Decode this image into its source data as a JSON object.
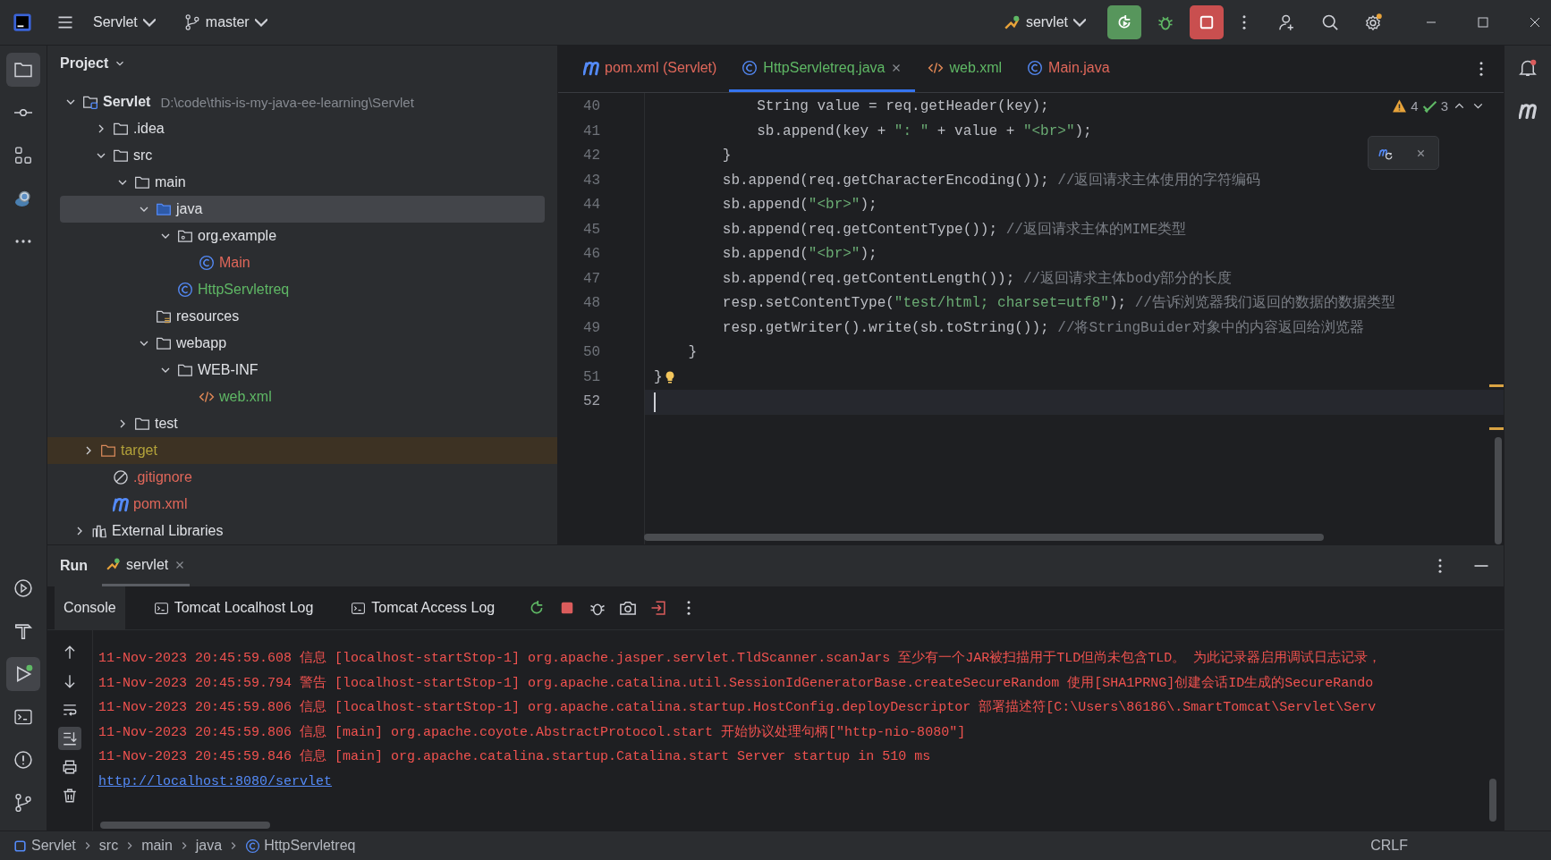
{
  "title_bar": {
    "project": "Servlet",
    "branch": "master",
    "run_config": "servlet"
  },
  "tool_strip": {
    "top": [
      {
        "kind": "folder",
        "selected": true
      },
      {
        "kind": "commit",
        "selected": false
      },
      {
        "kind": "structure",
        "selected": false
      },
      {
        "kind": "plugin",
        "selected": false
      },
      {
        "kind": "more",
        "selected": false
      }
    ],
    "bottom": [
      {
        "kind": "services",
        "selected": false
      },
      {
        "kind": "build",
        "selected": false
      },
      {
        "kind": "run",
        "selected": true
      },
      {
        "kind": "terminal",
        "selected": false
      },
      {
        "kind": "problems",
        "selected": false
      },
      {
        "kind": "git",
        "selected": false
      }
    ]
  },
  "project": {
    "title": "Project",
    "tree": [
      {
        "label": "Servlet",
        "hint": "D:\\code\\this-is-my-java-ee-learning\\Servlet",
        "kind": "module",
        "expanded": true,
        "selected": false,
        "children": [
          {
            "label": ".idea",
            "kind": "folder",
            "expanded": false,
            "selected": false
          },
          {
            "label": "src",
            "kind": "folder",
            "expanded": true,
            "selected": false,
            "children": [
              {
                "label": "main",
                "kind": "folder",
                "expanded": true,
                "selected": false,
                "children": [
                  {
                    "label": "java",
                    "kind": "source",
                    "expanded": true,
                    "selected": true,
                    "children": [
                      {
                        "label": "org.example",
                        "kind": "package",
                        "expanded": true,
                        "selected": false,
                        "children": [
                          {
                            "label": "Main",
                            "kind": "class",
                            "color": "#e0675a",
                            "selected": false
                          }
                        ]
                      },
                      {
                        "label": "HttpServletreq",
                        "kind": "class",
                        "color": "#5fb865",
                        "selected": false
                      }
                    ]
                  },
                  {
                    "label": "resources",
                    "kind": "resources",
                    "selected": false
                  },
                  {
                    "label": "webapp",
                    "kind": "folder",
                    "expanded": true,
                    "selected": false,
                    "children": [
                      {
                        "label": "WEB-INF",
                        "kind": "folder",
                        "expanded": true,
                        "selected": false,
                        "children": [
                          {
                            "label": "web.xml",
                            "kind": "xml",
                            "color": "#5fb865",
                            "selected": false
                          }
                        ]
                      }
                    ]
                  }
                ]
              },
              {
                "label": "test",
                "kind": "folder",
                "expanded": false,
                "selected": false
              }
            ]
          },
          {
            "label": "target",
            "kind": "excluded",
            "expanded": false,
            "color": "#b3a23a",
            "ignored": true,
            "selected": false
          },
          {
            "label": ".gitignore",
            "kind": "ignore",
            "color": "#e0675a",
            "selected": false
          },
          {
            "label": "pom.xml",
            "kind": "maven",
            "color": "#e0675a",
            "selected": false
          }
        ]
      },
      {
        "label": "External Libraries",
        "kind": "library",
        "expanded": false,
        "selected": false
      }
    ]
  },
  "editor": {
    "tabs": [
      {
        "label": "pom.xml (Servlet)",
        "kind": "maven",
        "color": "#e0675a",
        "selected": false
      },
      {
        "label": "HttpServletreq.java",
        "kind": "class",
        "color": "#5fb865",
        "selected": true
      },
      {
        "label": "web.xml",
        "kind": "xml",
        "color": "#5fb865",
        "selected": false
      },
      {
        "label": "Main.java",
        "kind": "class",
        "color": "#e0675a",
        "selected": false
      }
    ],
    "inspections": {
      "warnings": "4",
      "checks": "3"
    },
    "lines": [
      {
        "number": "40",
        "current": false,
        "segments": [
          {
            "kind": "code",
            "text": "            String value = req.getHeader(key);"
          }
        ]
      },
      {
        "number": "41",
        "current": false,
        "segments": [
          {
            "kind": "code",
            "text": "            sb.append(key + "
          },
          {
            "kind": "string",
            "text": "\": \""
          },
          {
            "kind": "code",
            "text": " + value + "
          },
          {
            "kind": "string",
            "text": "\"<br>\""
          },
          {
            "kind": "code",
            "text": ");"
          }
        ]
      },
      {
        "number": "42",
        "current": false,
        "segments": [
          {
            "kind": "code",
            "text": "        }"
          }
        ]
      },
      {
        "number": "43",
        "current": false,
        "segments": [
          {
            "kind": "code",
            "text": "        sb.append(req.getCharacterEncoding()); "
          },
          {
            "kind": "comment",
            "text": "//返回请求主体使用的字符编码"
          }
        ]
      },
      {
        "number": "44",
        "current": false,
        "segments": [
          {
            "kind": "code",
            "text": "        sb.append("
          },
          {
            "kind": "string",
            "text": "\"<br>\""
          },
          {
            "kind": "code",
            "text": ");"
          }
        ]
      },
      {
        "number": "45",
        "current": false,
        "segments": [
          {
            "kind": "code",
            "text": "        sb.append(req.getContentType()); "
          },
          {
            "kind": "comment",
            "text": "//返回请求主体的MIME类型"
          }
        ]
      },
      {
        "number": "46",
        "current": false,
        "segments": [
          {
            "kind": "code",
            "text": "        sb.append("
          },
          {
            "kind": "string",
            "text": "\"<br>\""
          },
          {
            "kind": "code",
            "text": ");"
          }
        ]
      },
      {
        "number": "47",
        "current": false,
        "segments": [
          {
            "kind": "code",
            "text": "        sb.append(req.getContentLength()); "
          },
          {
            "kind": "comment",
            "text": "//返回请求主体body部分的长度"
          }
        ]
      },
      {
        "number": "48",
        "current": false,
        "segments": [
          {
            "kind": "code",
            "text": "        resp.setContentType("
          },
          {
            "kind": "string",
            "text": "\"test/html; charset=utf8\""
          },
          {
            "kind": "code",
            "text": "); "
          },
          {
            "kind": "comment",
            "text": "//告诉浏览器我们返回的数据的数据类型"
          }
        ]
      },
      {
        "number": "49",
        "current": false,
        "segments": [
          {
            "kind": "code",
            "text": "        resp.getWriter().write(sb.toString()); "
          },
          {
            "kind": "comment",
            "text": "//将StringBuider对象中的内容返回给浏览器"
          }
        ]
      },
      {
        "number": "50",
        "current": false,
        "segments": [
          {
            "kind": "code",
            "text": "    }"
          }
        ]
      },
      {
        "number": "51",
        "current": false,
        "bulb": true,
        "segments": [
          {
            "kind": "code",
            "text": "}"
          }
        ]
      },
      {
        "number": "52",
        "current": true
      }
    ]
  },
  "run": {
    "title": "Run",
    "tabs": [
      {
        "label": "servlet",
        "selected": true
      }
    ],
    "console_tabs": [
      {
        "label": "Console",
        "selected": true
      },
      {
        "label": "Tomcat Localhost Log",
        "kind": "log",
        "selected": false
      },
      {
        "label": "Tomcat Access Log",
        "kind": "log",
        "selected": false
      }
    ],
    "lines": [
      {
        "kind": "log",
        "text": "11-Nov-2023 20:45:59.608 信息 [localhost-startStop-1] org.apache.jasper.servlet.TldScanner.scanJars 至少有一个JAR被扫描用于TLD但尚未包含TLD。 为此记录器启用调试日志记录，"
      },
      {
        "kind": "log",
        "text": "11-Nov-2023 20:45:59.794 警告 [localhost-startStop-1] org.apache.catalina.util.SessionIdGeneratorBase.createSecureRandom 使用[SHA1PRNG]创建会话ID生成的SecureRando"
      },
      {
        "kind": "log",
        "text": "11-Nov-2023 20:45:59.806 信息 [localhost-startStop-1] org.apache.catalina.startup.HostConfig.deployDescriptor 部署描述符[C:\\Users\\86186\\.SmartTomcat\\Servlet\\Serv"
      },
      {
        "kind": "log",
        "text": "11-Nov-2023 20:45:59.806 信息 [main] org.apache.coyote.AbstractProtocol.start 开始协议处理句柄[\"http-nio-8080\"]"
      },
      {
        "kind": "log",
        "text": "11-Nov-2023 20:45:59.846 信息 [main] org.apache.catalina.startup.Catalina.start Server startup in 510 ms"
      },
      {
        "kind": "link",
        "text": "http://localhost:8080/servlet"
      }
    ]
  },
  "status_bar": {
    "breadcrumbs": [
      {
        "label": "Servlet",
        "kind": "module"
      },
      {
        "label": "src"
      },
      {
        "label": "main"
      },
      {
        "label": "java"
      },
      {
        "label": "HttpServletreq",
        "kind": "class"
      }
    ],
    "line_separator": "CRLF"
  }
}
